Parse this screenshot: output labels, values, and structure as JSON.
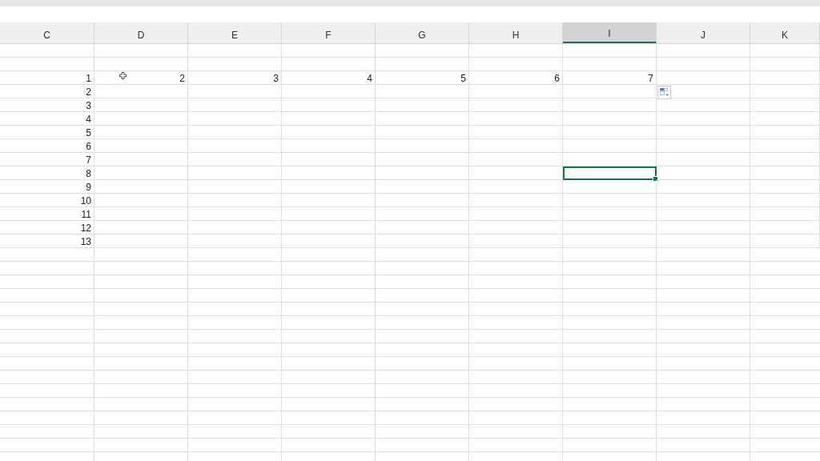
{
  "columns": [
    {
      "label": "C",
      "selected": false
    },
    {
      "label": "D",
      "selected": false
    },
    {
      "label": "E",
      "selected": false
    },
    {
      "label": "F",
      "selected": false
    },
    {
      "label": "G",
      "selected": false
    },
    {
      "label": "H",
      "selected": false
    },
    {
      "label": "I",
      "selected": true
    },
    {
      "label": "J",
      "selected": false
    },
    {
      "label": "K",
      "selected": false
    }
  ],
  "rows": [
    [
      {
        "selected": false
      },
      {
        "selected": false
      },
      {
        "selected": false
      },
      {
        "selected": false
      },
      {
        "selected": false
      },
      {
        "selected": false
      },
      {
        "selected": false
      },
      {
        "selected": false
      },
      {
        "selected": false
      }
    ],
    [
      {
        "selected": false
      },
      {
        "selected": false
      },
      {
        "selected": false
      },
      {
        "selected": false
      },
      {
        "selected": false
      },
      {
        "selected": false
      },
      {
        "selected": false
      },
      {
        "selected": false
      },
      {
        "selected": false
      }
    ],
    [
      {
        "text": "1",
        "selected": false
      },
      {
        "text": "2",
        "selected": false
      },
      {
        "text": "3",
        "selected": false
      },
      {
        "text": "4",
        "selected": false
      },
      {
        "text": "5",
        "selected": false
      },
      {
        "text": "6",
        "selected": false
      },
      {
        "text": "7",
        "selected": false
      },
      {
        "selected": false
      },
      {
        "selected": false
      }
    ],
    [
      {
        "text": "2",
        "selected": false
      },
      {
        "selected": false
      },
      {
        "selected": false
      },
      {
        "selected": false
      },
      {
        "selected": false
      },
      {
        "selected": false
      },
      {
        "selected": false
      },
      {
        "selected": false
      },
      {
        "selected": false
      }
    ],
    [
      {
        "text": "3",
        "selected": false
      },
      {
        "selected": false
      },
      {
        "selected": false
      },
      {
        "selected": false
      },
      {
        "selected": false
      },
      {
        "selected": false
      },
      {
        "selected": false
      },
      {
        "selected": false
      },
      {
        "selected": false
      }
    ],
    [
      {
        "text": "4",
        "selected": false
      },
      {
        "selected": false
      },
      {
        "selected": false
      },
      {
        "selected": false
      },
      {
        "selected": false
      },
      {
        "selected": false
      },
      {
        "selected": false
      },
      {
        "selected": false
      },
      {
        "selected": false
      }
    ],
    [
      {
        "text": "5",
        "selected": false
      },
      {
        "selected": false
      },
      {
        "selected": false
      },
      {
        "selected": false
      },
      {
        "selected": false
      },
      {
        "selected": false
      },
      {
        "selected": false
      },
      {
        "selected": false
      },
      {
        "selected": false
      }
    ],
    [
      {
        "text": "6",
        "selected": false
      },
      {
        "selected": false
      },
      {
        "selected": false
      },
      {
        "selected": false
      },
      {
        "selected": false
      },
      {
        "selected": false
      },
      {
        "selected": false
      },
      {
        "selected": false
      },
      {
        "selected": false
      }
    ],
    [
      {
        "text": "7",
        "selected": false
      },
      {
        "selected": false
      },
      {
        "selected": false
      },
      {
        "selected": false
      },
      {
        "selected": false
      },
      {
        "selected": false
      },
      {
        "selected": false
      },
      {
        "selected": false
      },
      {
        "selected": false
      }
    ],
    [
      {
        "text": "8",
        "selected": false
      },
      {
        "selected": false
      },
      {
        "selected": false
      },
      {
        "selected": false
      },
      {
        "selected": false
      },
      {
        "selected": false
      },
      {
        "selected": true
      },
      {
        "selected": false
      },
      {
        "selected": false
      }
    ],
    [
      {
        "text": "9",
        "selected": false
      },
      {
        "selected": false
      },
      {
        "selected": false
      },
      {
        "selected": false
      },
      {
        "selected": false
      },
      {
        "selected": false
      },
      {
        "selected": false
      },
      {
        "selected": false
      },
      {
        "selected": false
      }
    ],
    [
      {
        "text": "10",
        "selected": false
      },
      {
        "selected": false
      },
      {
        "selected": false
      },
      {
        "selected": false
      },
      {
        "selected": false
      },
      {
        "selected": false
      },
      {
        "selected": false
      },
      {
        "selected": false
      },
      {
        "selected": false
      }
    ],
    [
      {
        "text": "11",
        "selected": false
      },
      {
        "selected": false
      },
      {
        "selected": false
      },
      {
        "selected": false
      },
      {
        "selected": false
      },
      {
        "selected": false
      },
      {
        "selected": false
      },
      {
        "selected": false
      },
      {
        "selected": false
      }
    ],
    [
      {
        "text": "12",
        "selected": false
      },
      {
        "selected": false
      },
      {
        "selected": false
      },
      {
        "selected": false
      },
      {
        "selected": false
      },
      {
        "selected": false
      },
      {
        "selected": false
      },
      {
        "selected": false
      },
      {
        "selected": false
      }
    ],
    [
      {
        "text": "13",
        "selected": false
      },
      {
        "selected": false
      },
      {
        "selected": false
      },
      {
        "selected": false
      },
      {
        "selected": false
      },
      {
        "selected": false
      },
      {
        "selected": false
      },
      {
        "selected": false
      },
      {
        "selected": false
      }
    ]
  ]
}
